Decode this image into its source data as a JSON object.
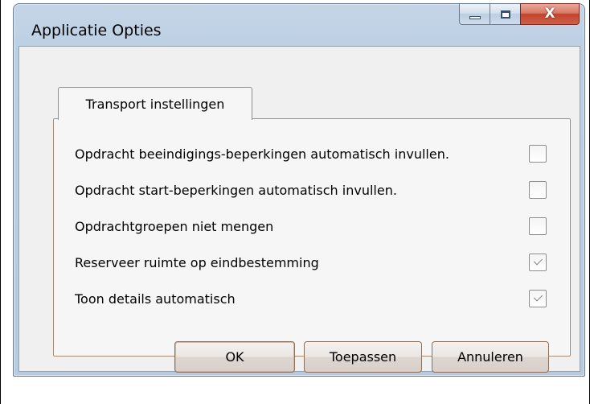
{
  "window": {
    "title": "Applicatie Opties",
    "close_symbol": "X"
  },
  "tab": {
    "label": "Transport instellingen"
  },
  "options": [
    {
      "label": "Opdracht beeindigings-beperkingen automatisch invullen.",
      "checked": false
    },
    {
      "label": "Opdracht start-beperkingen automatisch invullen.",
      "checked": false
    },
    {
      "label": "Opdrachtgroepen niet mengen",
      "checked": false
    },
    {
      "label": "Reserveer ruimte op eindbestemming",
      "checked": true
    },
    {
      "label": "Toon details automatisch",
      "checked": true
    }
  ],
  "buttons": {
    "ok": "OK",
    "apply": "Toepassen",
    "cancel": "Annuleren"
  }
}
